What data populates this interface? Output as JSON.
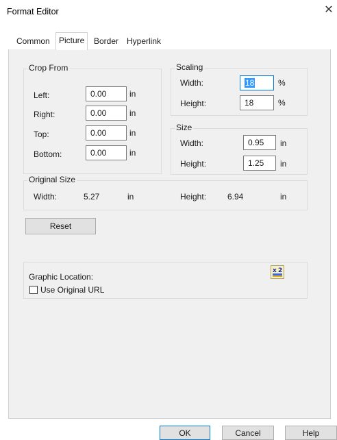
{
  "window": {
    "title": "Format Editor",
    "close_glyph": "✕"
  },
  "tabs": [
    {
      "label": "Common"
    },
    {
      "label": "Picture",
      "active": true
    },
    {
      "label": "Border"
    },
    {
      "label": "Hyperlink"
    }
  ],
  "crop_from": {
    "legend": "Crop From",
    "left": {
      "label": "Left:",
      "value": "0.00",
      "unit": "in"
    },
    "right": {
      "label": "Right:",
      "value": "0.00",
      "unit": "in"
    },
    "top": {
      "label": "Top:",
      "value": "0.00",
      "unit": "in"
    },
    "bottom": {
      "label": "Bottom:",
      "value": "0.00",
      "unit": "in"
    }
  },
  "scaling": {
    "legend": "Scaling",
    "width": {
      "label": "Width:",
      "value": "18",
      "unit": "%"
    },
    "height": {
      "label": "Height:",
      "value": "18",
      "unit": "%"
    }
  },
  "size": {
    "legend": "Size",
    "width": {
      "label": "Width:",
      "value": "0.95",
      "unit": "in"
    },
    "height": {
      "label": "Height:",
      "value": "1.25",
      "unit": "in"
    }
  },
  "original_size": {
    "legend": "Original Size",
    "width": {
      "label": "Width:",
      "value": "5.27",
      "unit": "in"
    },
    "height": {
      "label": "Height:",
      "value": "6.94",
      "unit": "in"
    }
  },
  "reset_button": "Reset",
  "graphic_location": {
    "label": "Graphic Location:",
    "use_original_url": "Use Original URL",
    "checked": false,
    "icon": "graphic-picker-icon"
  },
  "buttons": {
    "ok": "OK",
    "cancel": "Cancel",
    "help": "Help"
  },
  "colors": {
    "accent": "#0078d7",
    "selection": "#3399ff",
    "panel": "#f0f0f0"
  }
}
